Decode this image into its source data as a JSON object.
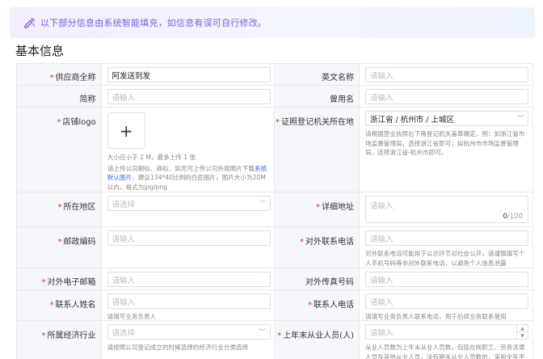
{
  "banner": {
    "icon": "ai-edit-icon",
    "text": "以下部分信息由系统智能填充，如信息有误可自行修改。"
  },
  "section_title": "基本信息",
  "rows": {
    "r1": {
      "l_label": "供应商全称",
      "l_value": "阿发送到发",
      "r_label": "英文名称",
      "r_placeholder": "请输入"
    },
    "r2": {
      "l_label": "简称",
      "l_placeholder": "请输入",
      "r_label": "曾用名",
      "r_placeholder": "请输入"
    },
    "r3": {
      "l_label": "店铺logo",
      "upload_plus": "+",
      "hint1": "大小应小于 2 M，最多上传 1 张",
      "hint2_a": "请上传公司橱标、商标，如无可上传公司外观照片下载",
      "hint2_link": "系统默认图片",
      "hint2_b": "，建议134*40比例的白底图片，图片大小为20M以内，格式为jpg/png",
      "r_label": "证照登记机关所在地",
      "r_value": "浙江省 / 杭州市 / 上城区",
      "r_hint": "请根据营业执照右下角登记机关盖章确定。例：如浙江省市场监督管理局，选择浙江省即可；如杭州市市场监督管理局，选择浙江省-杭州市即可。"
    },
    "r4": {
      "l_label": "所在地区",
      "l_placeholder": "请选择",
      "r_label": "详细地址",
      "r_placeholder": "请输入",
      "count": "0",
      "count_max": "/100"
    },
    "r5": {
      "l_label": "邮政编码",
      "l_placeholder": "请输入",
      "r_label": "对外联系电话",
      "r_placeholder": "请输入",
      "r_hint": "对外联系电话可能用于公示环节对社会公开，请谨慎填写个人手机号码等非对外联系电话，以避免个人信息泄露"
    },
    "r6": {
      "l_label": "对外电子邮箱",
      "l_placeholder": "请输入",
      "r_label": "对外传真号码",
      "r_placeholder": "请输入"
    },
    "r7": {
      "l_label": "联系人姓名",
      "l_placeholder": "请输入",
      "l_hint": "请填写业务负责人",
      "r_label": "联系人电话",
      "r_placeholder": "请输入",
      "r_hint": "请填写业务负责人联系电话，用于后续业务联系使用"
    },
    "r8": {
      "l_label": "所属经济行业",
      "l_placeholder": "请选择",
      "l_hint": "请按照公司登记成立的时候选择的经济行业分类选择",
      "r_label": "上年末从业人员(人)",
      "r_placeholder": "请输入",
      "r_hint": "从业人员数为上年末从业人员数，包括在岗职工、劳务派遣人员及其他从业人员，没有期末从业人员数的，采用全年平"
    }
  }
}
